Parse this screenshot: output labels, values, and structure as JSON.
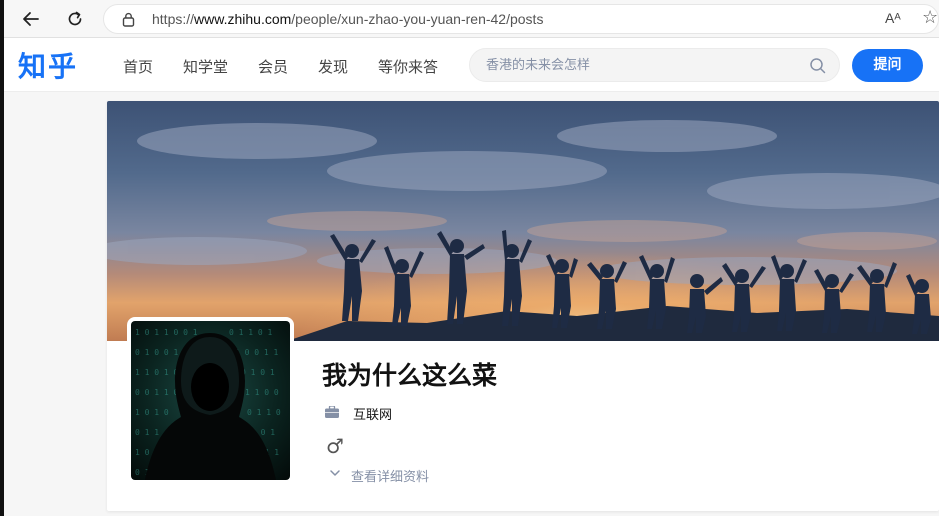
{
  "browser": {
    "url_prefix": "https://",
    "url_domain": "www.zhihu.com",
    "url_path": "/people/xun-zhao-you-yuan-ren-42/posts",
    "read_aloud_label": "Aᴬ"
  },
  "header": {
    "logo": "知乎",
    "nav": [
      "首页",
      "知学堂",
      "会员",
      "发现",
      "等你来答"
    ],
    "search_placeholder": "香港的未来会怎样",
    "ask_label": "提问",
    "brand_color": "#1772f6"
  },
  "profile": {
    "name": "我为什么这么菜",
    "industry": "互联网",
    "gender_symbol": "♂",
    "details_label": "查看详细资料"
  }
}
